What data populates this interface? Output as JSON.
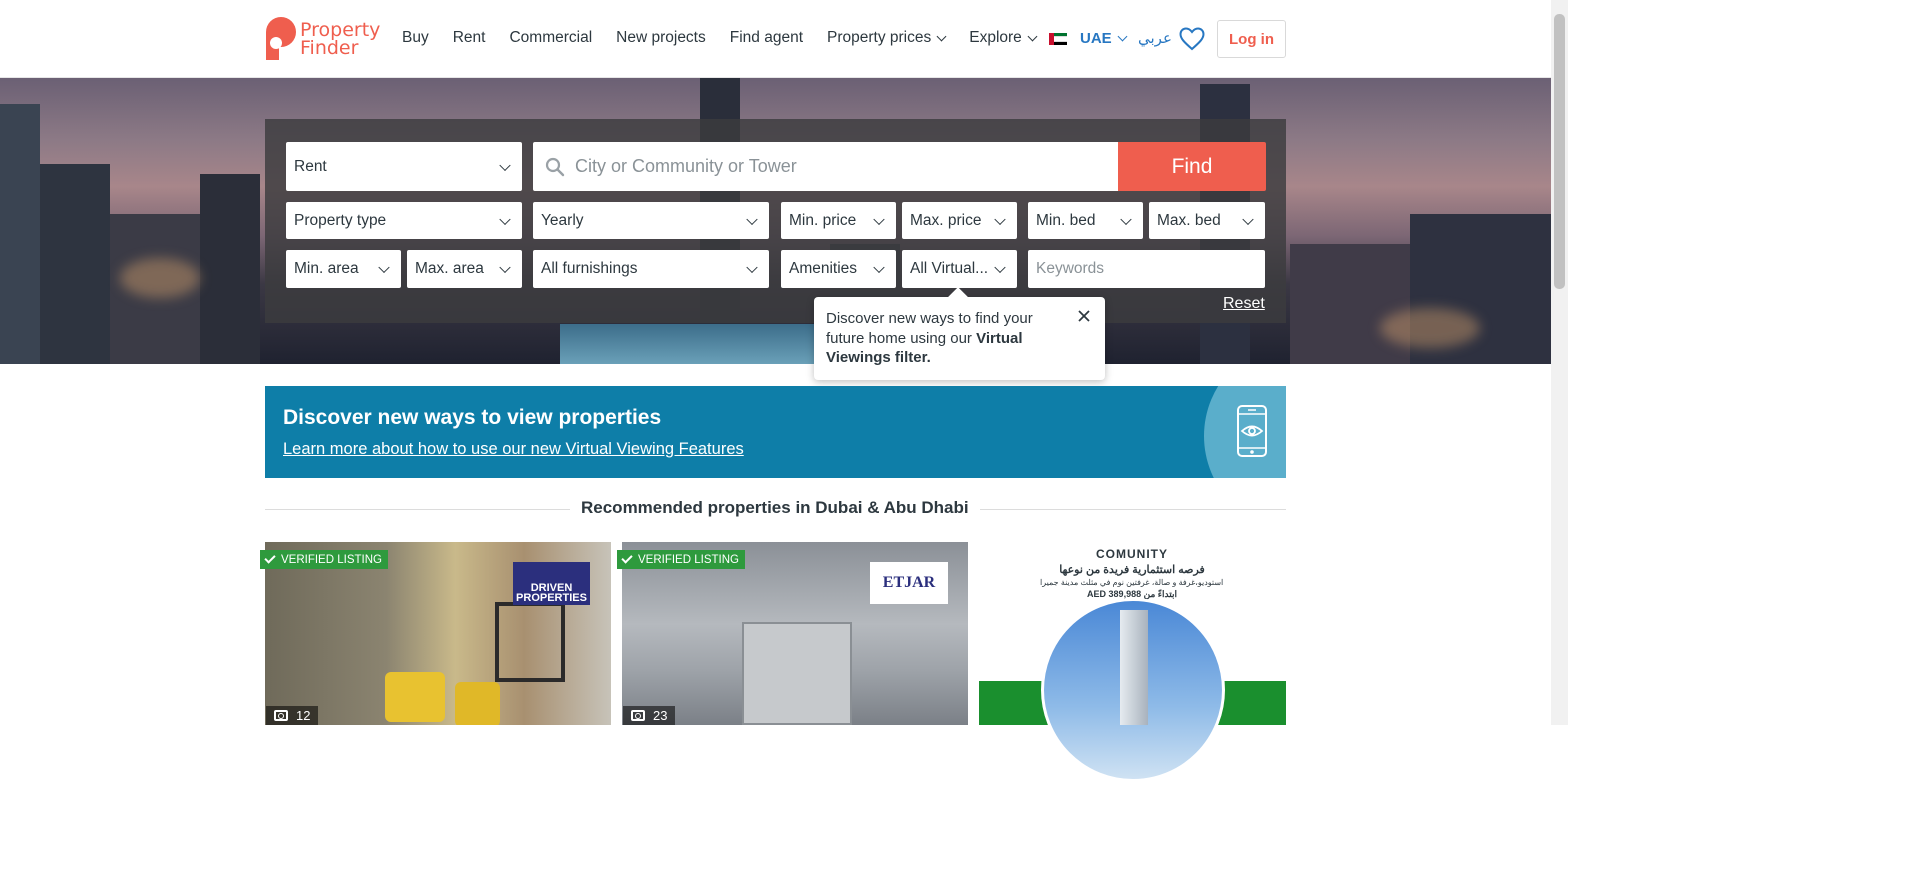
{
  "header": {
    "logo_line1": "Property",
    "logo_line2": "Finder",
    "nav": [
      "Buy",
      "Rent",
      "Commercial",
      "New projects",
      "Find agent",
      "Property prices",
      "Explore"
    ],
    "country": "UAE",
    "language": "عربي",
    "login": "Log in"
  },
  "search": {
    "category": "Rent",
    "location_placeholder": "City or Community or Tower",
    "find": "Find",
    "property_type": "Property type",
    "period": "Yearly",
    "min_price": "Min. price",
    "max_price": "Max. price",
    "min_bed": "Min. bed",
    "max_bed": "Max. bed",
    "min_area": "Min. area",
    "max_area": "Max. area",
    "furnishings": "All furnishings",
    "amenities": "Amenities",
    "virtual": "All Virtual...",
    "keywords_placeholder": "Keywords",
    "reset": "Reset"
  },
  "tooltip": {
    "text": "Discover new ways to find your future home using our ",
    "bold": "Virtual Viewings filter."
  },
  "banner": {
    "title": "Discover new ways to view properties",
    "link": "Learn more about how to use our new Virtual Viewing Features"
  },
  "recommended": {
    "title": "Recommended properties in Dubai & Abu Dhabi",
    "cards": [
      {
        "badge": "VERIFIED LISTING",
        "agency": "DRIVEN PROPERTIES",
        "photos": "12"
      },
      {
        "badge": "VERIFIED LISTING",
        "agency": "ETJAR",
        "photos": "23"
      }
    ],
    "ad": {
      "brand": "COMUNITY",
      "headline": "فرصه استثمارية فريدة من نوعها",
      "sub": "امتلك استوديو،غرفة و صالة، غرفتين نوم في مثلث مدينة جميرا",
      "price": "AED 389,988 ابتداءً من"
    }
  },
  "colors": {
    "brand": "#ef5e4e",
    "link": "#2777c2",
    "banner": "#0e7ea8",
    "verified": "#2e9a3d"
  }
}
